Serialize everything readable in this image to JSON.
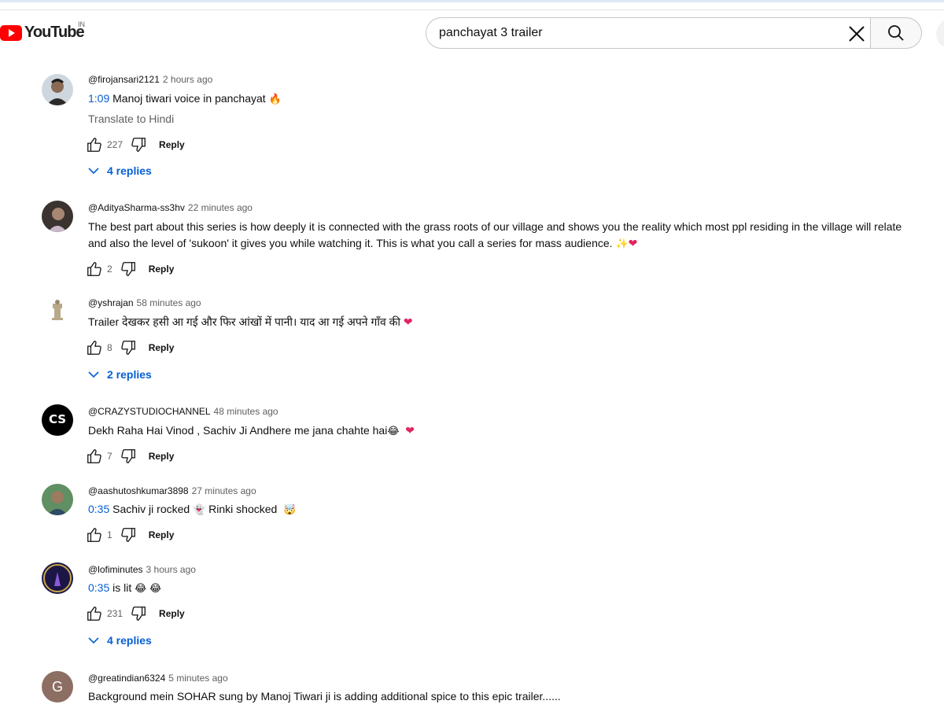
{
  "header": {
    "logo_text": "YouTube",
    "country": "IN",
    "search_value": "panchayat 3 trailer"
  },
  "comments": [
    {
      "handle": "@firojansari2121",
      "time": "2 hours ago",
      "timestamp": "1:09",
      "text": " Manoj tiwari voice in panchayat ",
      "emoji": "🔥",
      "translate": "Translate to Hindi",
      "likes": "227",
      "reply": "Reply",
      "replies": "4 replies"
    },
    {
      "handle": "@AdityaSharma-ss3hv",
      "time": "22 minutes ago",
      "line1": "The best part about this series is how deeply it is connected with the grass roots of our village and shows you the reality which most ppl residing in the village will relate",
      "line2": "and also the level of 'sukoon' it gives you while watching it. This is what you call a series for mass audience. ",
      "emoji": "✨",
      "heart": "❤",
      "likes": "2",
      "reply": "Reply"
    },
    {
      "handle": "@yshrajan",
      "time": "58 minutes ago",
      "text": "Trailer देखकर हसी आ गई और फिर आंखों में पानी। याद आ गई अपने गाँव की ",
      "heart": "❤",
      "likes": "8",
      "reply": "Reply",
      "replies": "2 replies"
    },
    {
      "handle": "@CRAZYSTUDIOCHANNEL",
      "time": "48 minutes ago",
      "text": "Dekh Raha Hai Vinod , Sachiv Ji Andhere me jana chahte hai",
      "emoji": "😂",
      "heart": "❤",
      "likes": "7",
      "reply": "Reply"
    },
    {
      "handle": "@aashutoshkumar3898",
      "time": "27 minutes ago",
      "timestamp": "0:35",
      "text": " Sachiv ji rocked ",
      "emoji1": "👻",
      "text2": " Rinki shocked ",
      "emoji2": "🤯",
      "likes": "1",
      "reply": "Reply"
    },
    {
      "handle": "@lofiminutes",
      "time": "3 hours ago",
      "timestamp": "0:35",
      "text": " is lit ",
      "emoji": "😂 😂",
      "likes": "231",
      "reply": "Reply",
      "replies": "4 replies"
    },
    {
      "handle": "@greatindian6324",
      "time": "5 minutes ago",
      "avatar_letter": "G",
      "text": "Background mein SOHAR sung by Manoj Tiwari ji is adding additional spice to this epic trailer......"
    }
  ],
  "colors": {
    "brand_red": "#ff0000",
    "link_blue": "#065fd4",
    "secondary_text": "#606060",
    "heart": "#e0245e"
  }
}
